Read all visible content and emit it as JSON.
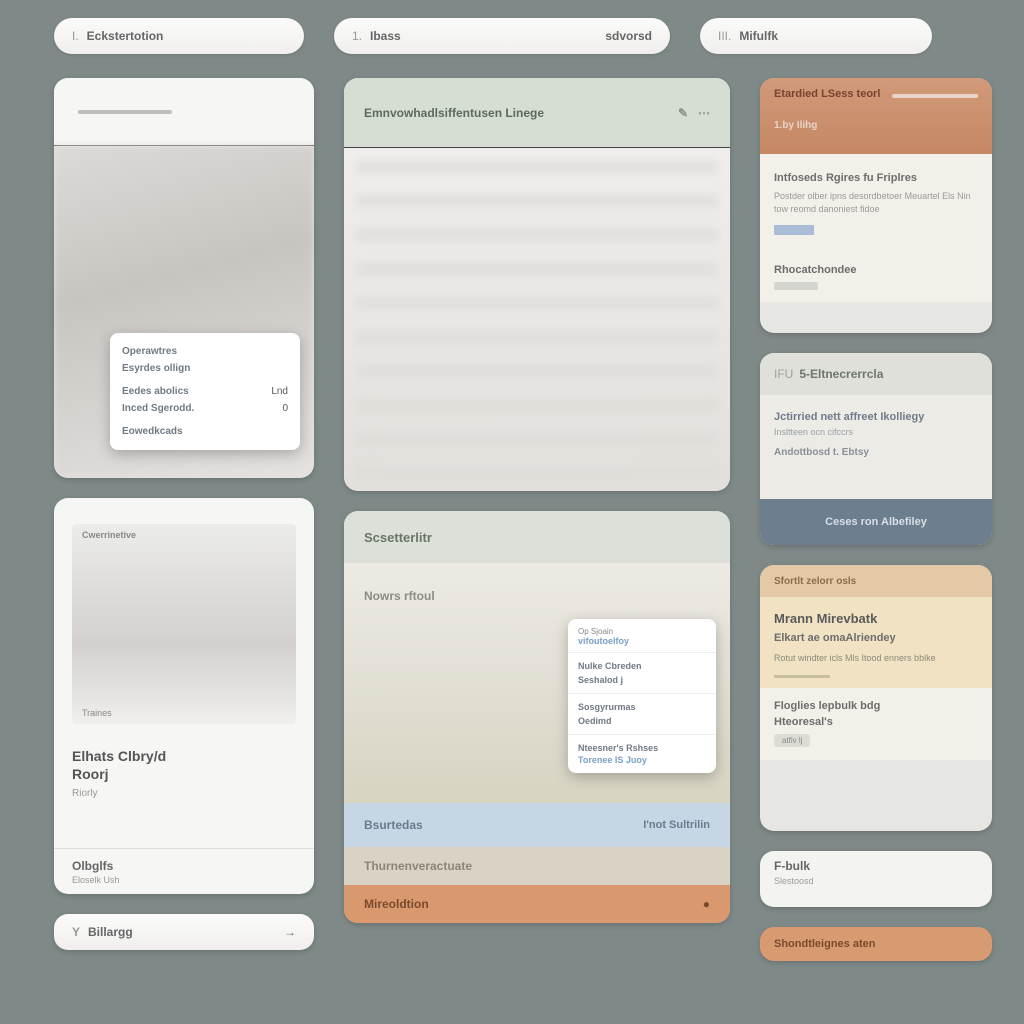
{
  "pills": {
    "p1": {
      "num": "I.",
      "label": "Eckstertotion"
    },
    "p2": {
      "num": "1.",
      "label1": "Ibass",
      "label2": "sdvorsd"
    },
    "p3": {
      "num": "III.",
      "label": "Mifulfk"
    }
  },
  "colA": {
    "card1": {
      "popup": {
        "r1": "Operawtres",
        "r2": "Esyrdes ollign",
        "r3l": "Eedes abolics",
        "r3r": "Lnd",
        "r4l": "Inced Sgerodd.",
        "r4r": "0",
        "r5": "Eowedkcads"
      }
    },
    "card2": {
      "tag": "Cwerrinetive",
      "cap": "Traines",
      "title1": "Elhats Clbry/d",
      "title2": "Roorj",
      "sub": "Riorly",
      "foot_title": "Olbglfs",
      "foot_sub": "Eloselk Ush"
    },
    "pill": {
      "num": "Y",
      "label": "Billargg",
      "arrow": "→"
    }
  },
  "colB": {
    "card1": {
      "title": "Emnvowhadlsiffentusen Linege",
      "icon1": "✎",
      "icon2": "⋯"
    },
    "card2": {
      "title": "Scsetterlitr",
      "body_label": "Nowrs rftoul",
      "popup": {
        "h1": "Op Sjoain",
        "h2": "vifoutoelfoy",
        "r1": "Nulke Cbreden",
        "r2": "Seshalod j",
        "r3": "Sosgyrurmas",
        "r4": "Oedimd",
        "r5": "Nteesner's Rshses",
        "r6": "Torenee IS Juoy"
      },
      "strip1a": "Bsurtedas",
      "strip1b": "I'not Sultrilin",
      "strip2": "Thurnenveractuate",
      "strip3": "Mireoldtion",
      "strip3dot": "●"
    }
  },
  "colC": {
    "card1": {
      "t1": "Etardied LSess teorl",
      "t2": "1.by Ilihg",
      "m1": "Intfoseds Rgires fu Friplres",
      "m2": "Postder olber ipns desordbetoer Meuartel Els Nin tow reomd danoniest fidoe",
      "b1": "Rhocatchondee"
    },
    "card2": {
      "pre": "IFU",
      "title": "5-Eltnecrerrcla",
      "l1": "Jctirried nett affreet Ikolliegy",
      "l2": "Insltteen ocn cifccrs",
      "l3": "Andottbosd t. Ebtsy",
      "foot": "Ceses ron Albefiley"
    },
    "card3": {
      "s1": "Sfortlt zelorr osls",
      "h2": "Mrann Mirevbatk",
      "h3": "Elkart ae omaAlriendey",
      "p": "Rotut windter icls Mls Itood enners bblke",
      "f1": "Floglies lepbulk bdg",
      "f2": "Hteoresal's",
      "chip": "atfiv lj"
    },
    "card4": {
      "t": "F-bulk",
      "s": "Slestoosd"
    },
    "card5": "Shondtleignes aten"
  }
}
